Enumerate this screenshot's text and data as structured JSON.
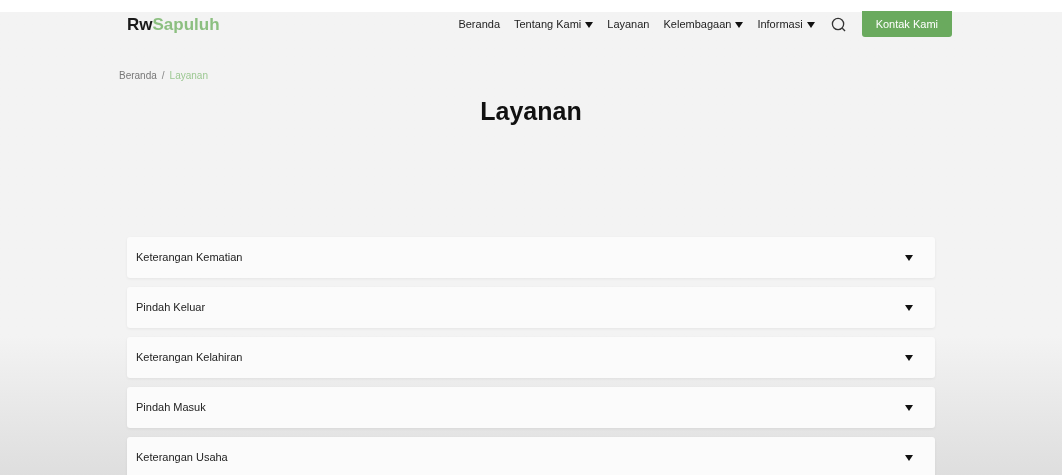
{
  "logo": {
    "first": "Rw",
    "second": "Sapuluh"
  },
  "nav": [
    {
      "label": "Beranda",
      "has_dropdown": false
    },
    {
      "label": "Tentang Kami",
      "has_dropdown": true
    },
    {
      "label": "Layanan",
      "has_dropdown": false
    },
    {
      "label": "Kelembagaan",
      "has_dropdown": true
    },
    {
      "label": "Informasi",
      "has_dropdown": true
    }
  ],
  "contact_button": "Kontak Kami",
  "breadcrumb": [
    {
      "label": "Beranda",
      "selected": false
    },
    {
      "label": "Layanan",
      "selected": true
    }
  ],
  "breadcrumb_separator": "/",
  "title": "Layanan",
  "services": [
    {
      "label": "Keterangan Kematian",
      "expanded": false
    },
    {
      "label": "Pindah Keluar",
      "expanded": false
    },
    {
      "label": "Keterangan Kelahiran",
      "expanded": false
    },
    {
      "label": "Pindah Masuk",
      "expanded": false
    },
    {
      "label": "Keterangan Usaha",
      "expanded": false
    }
  ]
}
